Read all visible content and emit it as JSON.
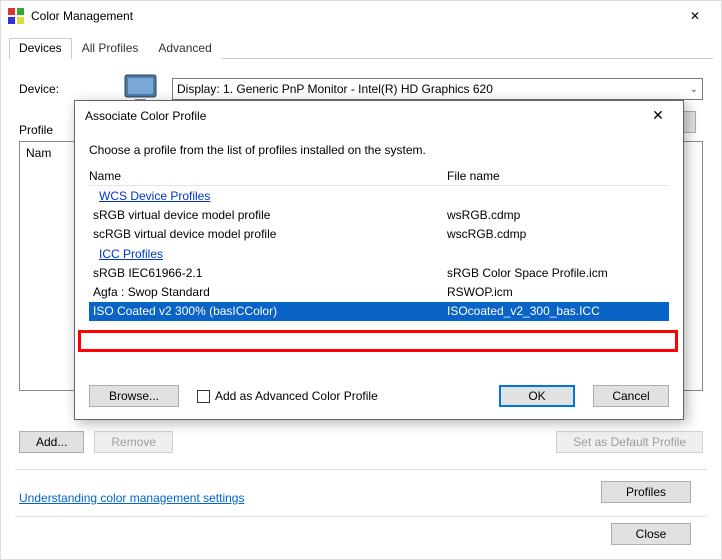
{
  "window": {
    "title": "Color Management",
    "tabs": [
      "Devices",
      "All Profiles",
      "Advanced"
    ],
    "device_label": "Device:",
    "device_selected": "Display: 1. Generic PnP Monitor - Intel(R) HD Graphics 620",
    "profiles_section_label": "Profile",
    "list_header_visible": "Nam",
    "buttons": {
      "add": "Add...",
      "remove": "Remove",
      "set_default": "Set as Default Profile",
      "profiles": "Profiles",
      "close": "Close"
    },
    "footer_link": "Understanding color management settings"
  },
  "dialog": {
    "title": "Associate Color Profile",
    "instruction": "Choose a profile from the list of profiles installed on the system.",
    "columns": {
      "name": "Name",
      "file": "File name"
    },
    "groups": {
      "wcs": "WCS Device Profiles",
      "icc": "ICC Profiles"
    },
    "rows": {
      "r1": {
        "name": "sRGB virtual device model profile",
        "file": "wsRGB.cdmp"
      },
      "r2": {
        "name": "scRGB virtual device model profile",
        "file": "wscRGB.cdmp"
      },
      "r3": {
        "name": "sRGB IEC61966-2.1",
        "file": "sRGB Color Space Profile.icm"
      },
      "r4": {
        "name": "Agfa : Swop Standard",
        "file": "RSWOP.icm"
      },
      "r5": {
        "name": "ISO Coated v2 300% (basICColor)",
        "file": "ISOcoated_v2_300_bas.ICC"
      }
    },
    "buttons": {
      "browse": "Browse...",
      "add_advanced": "Add as Advanced Color Profile",
      "ok": "OK",
      "cancel": "Cancel"
    }
  }
}
